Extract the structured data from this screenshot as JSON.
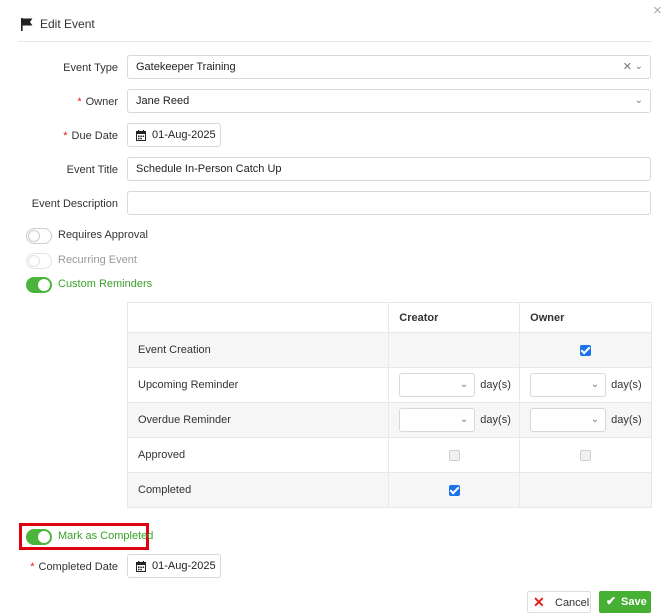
{
  "dialog": {
    "title": "Edit Event",
    "close_glyph": "×"
  },
  "form": {
    "event_type": {
      "label": "Event Type",
      "value": "Gatekeeper Training"
    },
    "owner": {
      "label": "Owner",
      "value": "Jane Reed",
      "required": true
    },
    "due_date": {
      "label": "Due Date",
      "value": "01-Aug-2025",
      "required": true
    },
    "event_title": {
      "label": "Event Title",
      "value": "Schedule In-Person Catch Up"
    },
    "event_description": {
      "label": "Event Description",
      "value": ""
    }
  },
  "toggles": {
    "requires_approval": {
      "label": "Requires Approval",
      "on": false
    },
    "recurring_event": {
      "label": "Recurring Event",
      "on": false,
      "disabled": true
    },
    "custom_reminders": {
      "label": "Custom Reminders",
      "on": true
    }
  },
  "reminders": {
    "headers": {
      "blank": "",
      "creator": "Creator",
      "owner": "Owner"
    },
    "rows": [
      {
        "label": "Event Creation",
        "creator": "none",
        "owner": "checked"
      },
      {
        "label": "Upcoming Reminder",
        "creator": "select",
        "owner": "select",
        "unit": "day(s)"
      },
      {
        "label": "Overdue Reminder",
        "creator": "select",
        "owner": "select",
        "unit": "day(s)"
      },
      {
        "label": "Approved",
        "creator": "unchecked",
        "owner": "unchecked"
      },
      {
        "label": "Completed",
        "creator": "checked",
        "owner": "none"
      }
    ]
  },
  "completion": {
    "mark_completed": {
      "label": "Mark as Completed",
      "on": true
    },
    "completed_date": {
      "label": "Completed Date",
      "value": "01-Aug-2025",
      "required": true
    }
  },
  "actions": {
    "cancel_label": "Cancel",
    "save_label": "Save"
  },
  "colors": {
    "accent_green": "#4bb43c",
    "checkbox_blue": "#1a73e8",
    "required_red": "#e02020",
    "highlight_red": "#e0000f"
  },
  "icons": {
    "flag": "flag-icon",
    "calendar": "calendar-icon",
    "chevron": "chevron-down-icon",
    "clear": "clear-icon",
    "close": "close-icon",
    "check": "check-icon"
  }
}
